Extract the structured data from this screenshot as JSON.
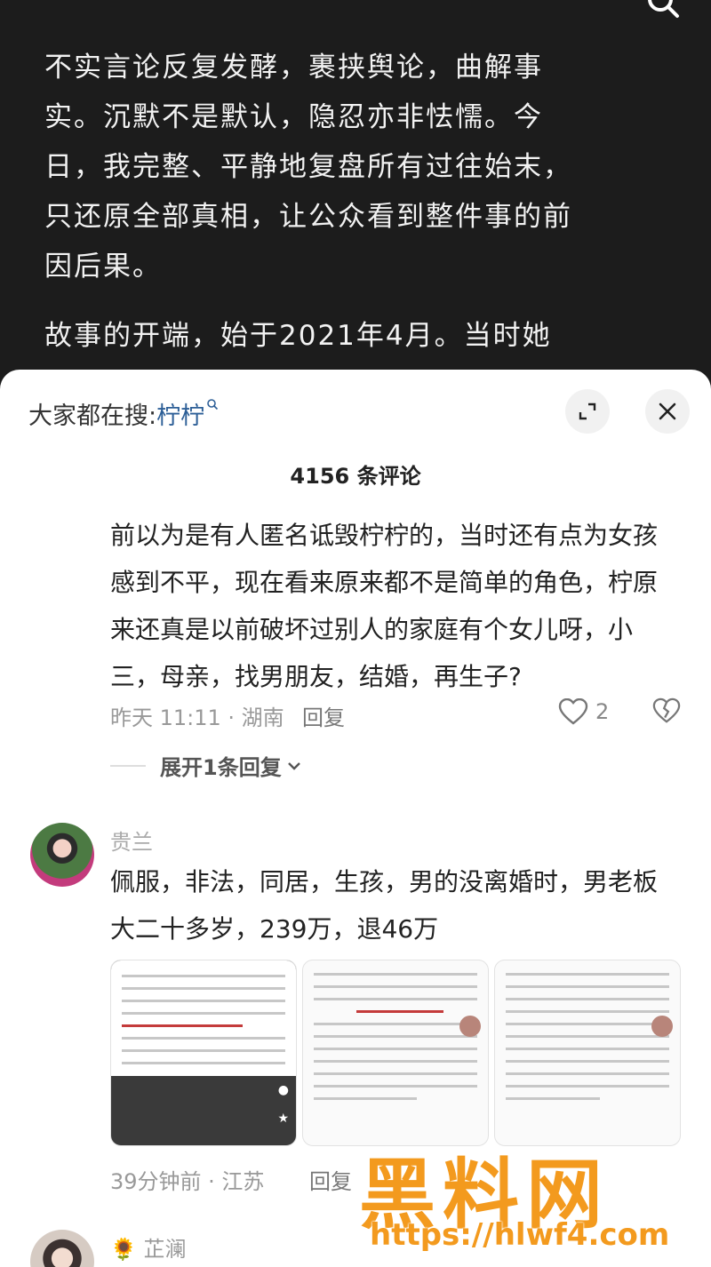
{
  "article": {
    "paragraph1": "不实言论反复发酵，裹挟舆论，曲解事实。沉默不是默认，隐忍亦非怯懦。今日，我完整、平静地复盘所有过往始末，只还原全部真相，让公众看到整件事的前因后果。",
    "paragraph2": "故事的开端，始于2021年4月。当时她"
  },
  "sheet": {
    "hot_label": "大家都在搜:",
    "hot_keyword": "柠柠",
    "comment_count": "4156 条评论"
  },
  "comments": [
    {
      "text": "前以为是有人匿名诋毁柠柠的，当时还有点为女孩感到不平，现在看来原来都不是简单的角色，柠原来还真是以前破坏过别人的家庭有个女儿呀，小三，母亲，找男朋友，结婚，再生子?",
      "time_location": "昨天 11:11 · 湖南",
      "reply": "回复",
      "likes": "2",
      "expand": "展开1条回复"
    },
    {
      "user": "贵兰",
      "text": "佩服，非法，同居，生孩，男的没离婚时，男老板大二十多岁，239万，退46万",
      "time_location": "39分钟前 · 江苏",
      "reply": "回复"
    },
    {
      "user": "🌻 芷澜"
    }
  ],
  "watermark": {
    "brand": "黑料网",
    "url": "https://hlwf4.com"
  },
  "icons": [
    "search-icon",
    "expand-icon",
    "close-icon",
    "heart-icon",
    "broken-heart-icon",
    "chevron-down-icon",
    "comment-icon",
    "star-icon"
  ]
}
